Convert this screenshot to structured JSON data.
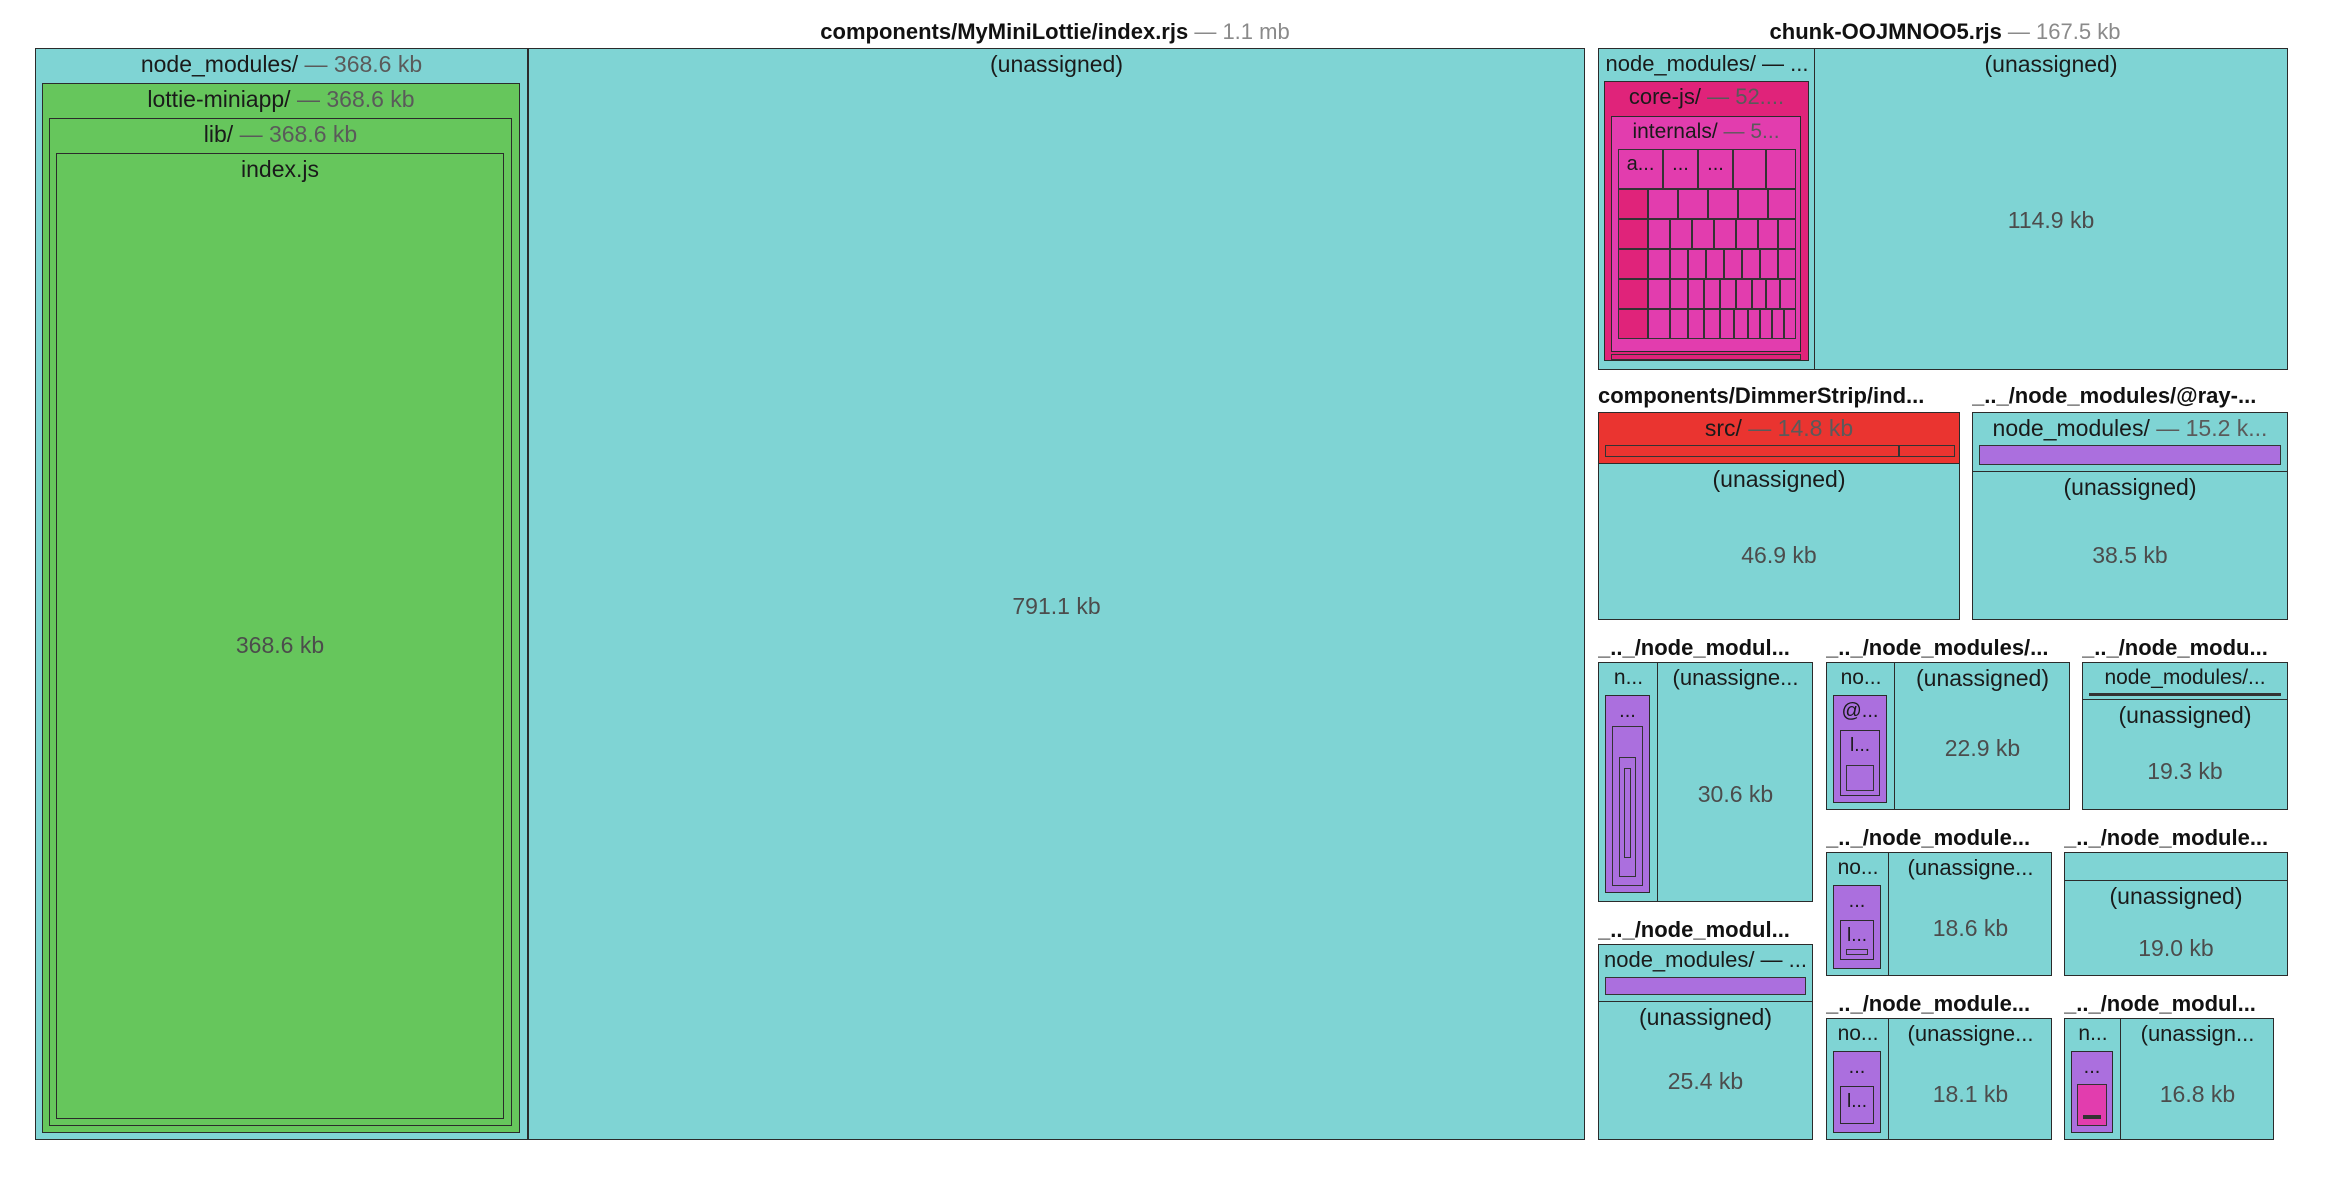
{
  "chart_data": {
    "type": "treemap",
    "colors": {
      "teal": "#7fd4d4",
      "green": "#66c65c",
      "pink": "#e0237a",
      "magenta": "#e23dae",
      "red": "#ea3430",
      "purple": "#ab6fde"
    },
    "groups": [
      {
        "id": "g-mylottie",
        "title": "components/MyMiniLottie/index.rjs",
        "size": "— 1.1 mb",
        "nodes": [
          {
            "id": "g1-nm",
            "label": "node_modules/",
            "size": "— 368.6 kb",
            "color": "teal"
          },
          {
            "id": "g1-lottie",
            "label": "lottie-miniapp/",
            "size": "— 368.6 kb",
            "color": "green"
          },
          {
            "id": "g1-lib",
            "label": "lib/",
            "size": "— 368.6 kb",
            "color": "green"
          },
          {
            "id": "g1-index",
            "label": "index.js",
            "size": "",
            "value": "368.6 kb",
            "color": "green"
          },
          {
            "id": "g1-unassigned",
            "label": "(unassigned)",
            "size": "",
            "value": "791.1 kb",
            "color": "teal"
          }
        ]
      },
      {
        "id": "g-chunk",
        "title": "chunk-OOJMNOO5.rjs",
        "size": "— 167.5 kb",
        "nodes": [
          {
            "id": "g2-nm",
            "label": "node_modules/ — ...",
            "color": "teal"
          },
          {
            "id": "g2-corejs",
            "label": "core-js/",
            "size": "— 52....",
            "color": "pink"
          },
          {
            "id": "g2-internals",
            "label": "internals/",
            "size": "— 5...",
            "color": "magenta"
          },
          {
            "id": "g2-a",
            "label": "a...",
            "color": "magenta"
          },
          {
            "id": "g2-b",
            "label": "...",
            "color": "magenta"
          },
          {
            "id": "g2-c",
            "label": "...",
            "color": "magenta"
          },
          {
            "id": "g2-unassigned",
            "label": "(unassigned)",
            "value": "114.9 kb",
            "color": "teal"
          }
        ]
      },
      {
        "id": "g-dimmer",
        "title": "components/DimmerStrip/ind...",
        "size": "",
        "nodes": [
          {
            "id": "g3-src",
            "label": "src/",
            "size": "— 14.8 kb",
            "color": "red"
          },
          {
            "id": "g3-unassigned",
            "label": "(unassigned)",
            "value": "46.9 kb",
            "color": "teal"
          }
        ]
      },
      {
        "id": "g-ray",
        "title": "_.._/node_modules/@ray-...",
        "size": "",
        "nodes": [
          {
            "id": "g4-nm",
            "label": "node_modules/",
            "size": "— 15.2 k...",
            "color": "teal"
          },
          {
            "id": "g4-unassigned",
            "label": "(unassigned)",
            "value": "38.5 kb",
            "color": "teal"
          }
        ]
      },
      {
        "id": "g-a",
        "title": "_.._/node_modul...",
        "size": "",
        "nodes": [
          {
            "id": "g5-n",
            "label": "n...",
            "color": "teal"
          },
          {
            "id": "g5-dots",
            "label": "...",
            "color": "purple"
          },
          {
            "id": "g5-unassigned",
            "label": "(unassigne...",
            "value": "30.6 kb",
            "color": "teal"
          }
        ]
      },
      {
        "id": "g-b",
        "title": "_.._/node_modules/...",
        "size": "",
        "nodes": [
          {
            "id": "g6-no",
            "label": "no...",
            "color": "teal"
          },
          {
            "id": "g6-at",
            "label": "@...",
            "color": "purple"
          },
          {
            "id": "g6-l",
            "label": "l...",
            "color": "purple"
          },
          {
            "id": "g6-unassigned",
            "label": "(unassigned)",
            "value": "22.9 kb",
            "color": "teal"
          }
        ]
      },
      {
        "id": "g-c",
        "title": "_.._/node_modu...",
        "size": "",
        "nodes": [
          {
            "id": "g7-nm",
            "label": "node_modules/...",
            "color": "teal"
          },
          {
            "id": "g7-unassigned",
            "label": "(unassigned)",
            "value": "19.3 kb",
            "color": "teal"
          }
        ]
      },
      {
        "id": "g-d",
        "title": "_.._/node_module...",
        "size": "",
        "nodes": [
          {
            "id": "g8-no",
            "label": "no...",
            "color": "teal"
          },
          {
            "id": "g8-dots",
            "label": "...",
            "color": "purple"
          },
          {
            "id": "g8-l",
            "label": "l...",
            "color": "purple"
          },
          {
            "id": "g8-unassigned",
            "label": "(unassigne...",
            "value": "18.6 kb",
            "color": "teal"
          }
        ]
      },
      {
        "id": "g-e",
        "title": "_.._/node_module...",
        "size": "",
        "nodes": [
          {
            "id": "g9-unassigned",
            "label": "(unassigned)",
            "value": "19.0 kb",
            "color": "teal"
          }
        ]
      },
      {
        "id": "g-f",
        "title": "_.._/node_modul...",
        "size": "",
        "nodes": [
          {
            "id": "g10-nm",
            "label": "node_modules/ — ...",
            "color": "teal"
          },
          {
            "id": "g10-unassigned",
            "label": "(unassigned)",
            "value": "25.4 kb",
            "color": "teal"
          }
        ]
      },
      {
        "id": "g-g",
        "title": "_.._/node_module...",
        "size": "",
        "nodes": [
          {
            "id": "g11-no",
            "label": "no...",
            "color": "teal"
          },
          {
            "id": "g11-dots",
            "label": "...",
            "color": "purple"
          },
          {
            "id": "g11-l",
            "label": "l...",
            "color": "purple"
          },
          {
            "id": "g11-unassigned",
            "label": "(unassigne...",
            "value": "18.1 kb",
            "color": "teal"
          }
        ]
      },
      {
        "id": "g-h",
        "title": "_.._/node_modul...",
        "size": "",
        "nodes": [
          {
            "id": "g12-n",
            "label": "n...",
            "color": "teal"
          },
          {
            "id": "g12-dots",
            "label": "...",
            "color": "purple"
          },
          {
            "id": "g12-unassigned",
            "label": "(unassign...",
            "value": "16.8 kb",
            "color": "teal"
          }
        ]
      }
    ]
  }
}
